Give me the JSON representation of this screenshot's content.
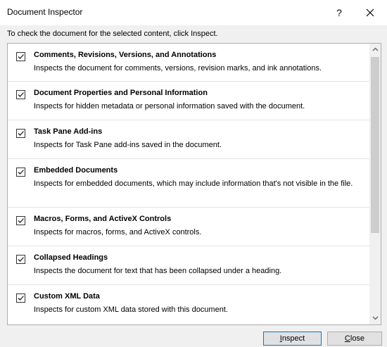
{
  "window": {
    "title": "Document Inspector",
    "help_label": "?",
    "close_label": "✕"
  },
  "instruction": "To check the document for the selected content, click Inspect.",
  "items": [
    {
      "title": "Comments, Revisions, Versions, and Annotations",
      "description": "Inspects the document for comments, versions, revision marks, and ink annotations.",
      "checked": true
    },
    {
      "title": "Document Properties and Personal Information",
      "description": "Inspects for hidden metadata or personal information saved with the document.",
      "checked": true
    },
    {
      "title": "Task Pane Add-ins",
      "description": "Inspects for Task Pane add-ins saved in the document.",
      "checked": true
    },
    {
      "title": "Embedded Documents",
      "description": "Inspects for embedded documents, which may include information that's not visible in the file.",
      "checked": true
    },
    {
      "title": "Macros, Forms, and ActiveX Controls",
      "description": "Inspects for macros, forms, and ActiveX controls.",
      "checked": true
    },
    {
      "title": "Collapsed Headings",
      "description": "Inspects the document for text that has been collapsed under a heading.",
      "checked": true
    },
    {
      "title": "Custom XML Data",
      "description": "Inspects for custom XML data stored with this document.",
      "checked": true
    }
  ],
  "scrollbar": {
    "up_icon": "chevron-up",
    "down_icon": "chevron-down"
  },
  "buttons": {
    "inspect_label": "Inspect",
    "close_label": "Close"
  },
  "colors": {
    "accent": "#0078d7",
    "dialog_bg": "#f0f0f0"
  }
}
